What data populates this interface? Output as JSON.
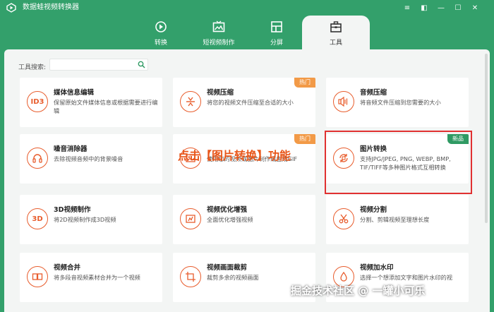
{
  "app": {
    "title": "数据蛙视频转换器",
    "brand_color": "#33a06b",
    "accent_color": "#e85c2c"
  },
  "window_controls": [
    {
      "name": "menu-icon",
      "glyph": "≡"
    },
    {
      "name": "theme-icon",
      "glyph": "◧"
    },
    {
      "name": "minimize-icon",
      "glyph": "—"
    },
    {
      "name": "maximize-icon",
      "glyph": "☐"
    },
    {
      "name": "close-icon",
      "glyph": "✕"
    }
  ],
  "tabs": [
    {
      "label": "转换",
      "icon": "convert-icon",
      "active": false
    },
    {
      "label": "短视频制作",
      "icon": "short-video-icon",
      "active": false
    },
    {
      "label": "分屏",
      "icon": "split-screen-icon",
      "active": false
    },
    {
      "label": "工具",
      "icon": "toolbox-icon",
      "active": true
    }
  ],
  "search": {
    "label": "工具搜索:",
    "value": "",
    "placeholder": ""
  },
  "cards": [
    {
      "title": "媒体信息编辑",
      "desc": "保留原始文件媒体信息或根据需要进行编辑",
      "icon": "id3-icon",
      "icon_text": "ID3",
      "badge": ""
    },
    {
      "title": "视频压缩",
      "desc": "将您的视频文件压缩至合适的大小",
      "icon": "video-compress-icon",
      "badge": "热门"
    },
    {
      "title": "音频压缩",
      "desc": "将音频文件压缩到您需要的大小",
      "icon": "audio-compress-icon",
      "badge": ""
    },
    {
      "title": "噪音消除器",
      "desc": "去除视频音频中的背景噪音",
      "icon": "noise-remove-icon",
      "badge": ""
    },
    {
      "title": "",
      "desc": "使用您的视频或图片制作或生成GIF",
      "icon": "gif-icon",
      "badge": "热门"
    },
    {
      "title": "图片转换",
      "desc": "支持JPG/JPEG, PNG, WEBP, BMP, TIF/TIFF等多种图片格式互相转换",
      "icon": "image-convert-icon",
      "badge": "新品"
    },
    {
      "title": "3D视频制作",
      "desc": "将2D视频制作成3D视频",
      "icon": "3d-icon",
      "icon_text": "3D",
      "badge": ""
    },
    {
      "title": "视频优化增强",
      "desc": "全面优化增强视频",
      "icon": "enhance-icon",
      "badge": ""
    },
    {
      "title": "视频分割",
      "desc": "分割、剪辑视频至理想长度",
      "icon": "scissors-icon",
      "badge": ""
    },
    {
      "title": "视频合并",
      "desc": "将多段音视频素材合并为一个视频",
      "icon": "merge-icon",
      "badge": ""
    },
    {
      "title": "视频画面裁剪",
      "desc": "裁剪多余的视频画面",
      "icon": "crop-icon",
      "badge": ""
    },
    {
      "title": "视频加水印",
      "desc": "选择一个想添加文字和图片水印的视",
      "icon": "watermark-icon",
      "badge": ""
    }
  ],
  "annotation": "点击【图片转换】功能",
  "watermark": "掘金技术社区 @ 一罐小可乐"
}
